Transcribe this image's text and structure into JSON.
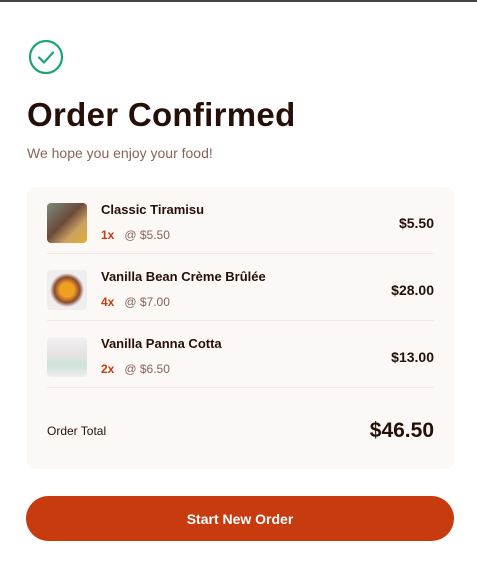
{
  "header": {
    "title": "Order Confirmed",
    "subtitle": "We hope you enjoy your food!",
    "icon": "check-circle-icon",
    "accent": "#1ea575"
  },
  "items": [
    {
      "name": "Classic Tiramisu",
      "qty": "1x",
      "unit_price": "@ $5.50",
      "total": "$5.50"
    },
    {
      "name": "Vanilla Bean Crème Brûlée",
      "qty": "4x",
      "unit_price": "@ $7.00",
      "total": "$28.00"
    },
    {
      "name": "Vanilla Panna Cotta",
      "qty": "2x",
      "unit_price": "@ $6.50",
      "total": "$13.00"
    }
  ],
  "summary": {
    "label": "Order Total",
    "value": "$46.50"
  },
  "actions": {
    "start_new": "Start New Order"
  },
  "colors": {
    "primary": "#c73b0f",
    "text": "#260f08"
  }
}
